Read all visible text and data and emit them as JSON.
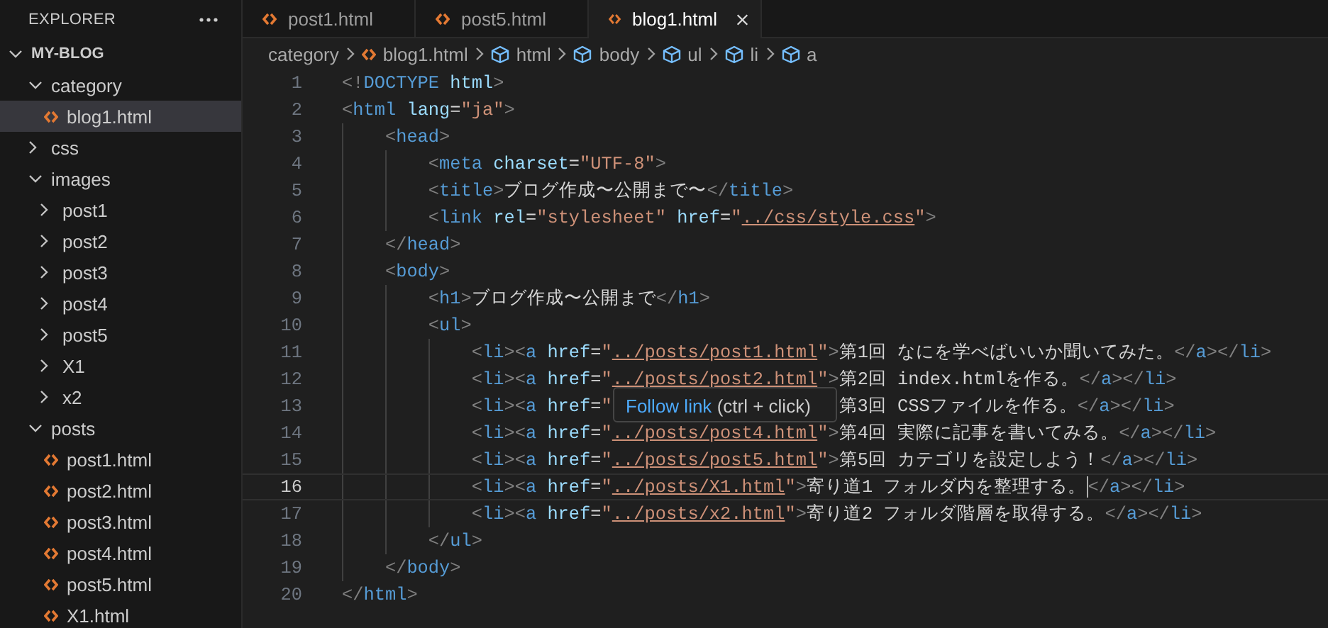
{
  "explorer": {
    "title": "EXPLORER"
  },
  "workspace": {
    "name": "MY-BLOG",
    "expanded": true,
    "children": [
      {
        "label": "category",
        "kind": "folder",
        "expanded": true,
        "selected": false,
        "children": [
          {
            "label": "blog1.html",
            "kind": "file",
            "selected": true
          }
        ]
      },
      {
        "label": "css",
        "kind": "folder",
        "expanded": false,
        "selected": false
      },
      {
        "label": "images",
        "kind": "folder",
        "expanded": true,
        "selected": false,
        "children": [
          {
            "label": "post1",
            "kind": "folder",
            "expanded": false,
            "selected": false
          },
          {
            "label": "post2",
            "kind": "folder",
            "expanded": false,
            "selected": false
          },
          {
            "label": "post3",
            "kind": "folder",
            "expanded": false,
            "selected": false
          },
          {
            "label": "post4",
            "kind": "folder",
            "expanded": false,
            "selected": false
          },
          {
            "label": "post5",
            "kind": "folder",
            "expanded": false,
            "selected": false
          },
          {
            "label": "X1",
            "kind": "folder",
            "expanded": false,
            "selected": false
          },
          {
            "label": "x2",
            "kind": "folder",
            "expanded": false,
            "selected": false
          }
        ]
      },
      {
        "label": "posts",
        "kind": "folder",
        "expanded": true,
        "selected": false,
        "children": [
          {
            "label": "post1.html",
            "kind": "file",
            "selected": false
          },
          {
            "label": "post2.html",
            "kind": "file",
            "selected": false
          },
          {
            "label": "post3.html",
            "kind": "file",
            "selected": false
          },
          {
            "label": "post4.html",
            "kind": "file",
            "selected": false
          },
          {
            "label": "post5.html",
            "kind": "file",
            "selected": false
          },
          {
            "label": "X1.html",
            "kind": "file",
            "selected": false
          }
        ]
      }
    ]
  },
  "tabs": [
    {
      "label": "post1.html",
      "selected": false
    },
    {
      "label": "post5.html",
      "selected": false
    },
    {
      "label": "blog1.html",
      "selected": true
    }
  ],
  "breadcrumb": [
    {
      "label": "category",
      "kind": "folder"
    },
    {
      "label": "blog1.html",
      "kind": "file"
    },
    {
      "label": "html",
      "kind": "element"
    },
    {
      "label": "body",
      "kind": "element"
    },
    {
      "label": "ul",
      "kind": "element"
    },
    {
      "label": "li",
      "kind": "element"
    },
    {
      "label": "a",
      "kind": "element"
    }
  ],
  "lines": [
    {
      "number": "1",
      "current": false,
      "tokens": [
        {
          "kind": "punct",
          "text": "<!"
        },
        {
          "kind": "tag",
          "text": "DOCTYPE"
        },
        {
          "kind": "attr",
          "text": " html"
        },
        {
          "kind": "punct",
          "text": ">"
        }
      ]
    },
    {
      "number": "2",
      "current": false,
      "tokens": [
        {
          "kind": "punct",
          "text": "<"
        },
        {
          "kind": "tag",
          "text": "html"
        },
        {
          "kind": "attr",
          "text": " lang"
        },
        {
          "kind": "text",
          "text": "="
        },
        {
          "kind": "string",
          "text": "\"ja\""
        },
        {
          "kind": "punct",
          "text": ">"
        }
      ],
      "children": [
        {
          "number": "3",
          "current": false,
          "tokens": [
            {
              "kind": "punct",
              "text": "<"
            },
            {
              "kind": "tag",
              "text": "head"
            },
            {
              "kind": "punct",
              "text": ">"
            }
          ],
          "children": [
            {
              "number": "4",
              "current": false,
              "tokens": [
                {
                  "kind": "punct",
                  "text": "<"
                },
                {
                  "kind": "tag",
                  "text": "meta"
                },
                {
                  "kind": "attr",
                  "text": " charset"
                },
                {
                  "kind": "text",
                  "text": "="
                },
                {
                  "kind": "string",
                  "text": "\"UTF-8\""
                },
                {
                  "kind": "punct",
                  "text": ">"
                }
              ]
            },
            {
              "number": "5",
              "current": false,
              "tokens": [
                {
                  "kind": "punct",
                  "text": "<"
                },
                {
                  "kind": "tag",
                  "text": "title"
                },
                {
                  "kind": "punct",
                  "text": ">"
                },
                {
                  "kind": "text",
                  "text": "ブログ作成〜公開まで〜"
                },
                {
                  "kind": "punct",
                  "text": "</"
                },
                {
                  "kind": "tag",
                  "text": "title"
                },
                {
                  "kind": "punct",
                  "text": ">"
                }
              ]
            },
            {
              "number": "6",
              "current": false,
              "tokens": [
                {
                  "kind": "punct",
                  "text": "<"
                },
                {
                  "kind": "tag",
                  "text": "link"
                },
                {
                  "kind": "attr",
                  "text": " rel"
                },
                {
                  "kind": "text",
                  "text": "="
                },
                {
                  "kind": "string",
                  "text": "\"stylesheet\""
                },
                {
                  "kind": "attr",
                  "text": " href"
                },
                {
                  "kind": "text",
                  "text": "="
                },
                {
                  "kind": "string",
                  "text": "\""
                },
                {
                  "kind": "link",
                  "text": "../css/style.css"
                },
                {
                  "kind": "string",
                  "text": "\""
                },
                {
                  "kind": "punct",
                  "text": ">"
                }
              ]
            }
          ]
        },
        {
          "number": "7",
          "current": false,
          "tokens": [
            {
              "kind": "punct",
              "text": "</"
            },
            {
              "kind": "tag",
              "text": "head"
            },
            {
              "kind": "punct",
              "text": ">"
            }
          ]
        },
        {
          "number": "8",
          "current": false,
          "tokens": [
            {
              "kind": "punct",
              "text": "<"
            },
            {
              "kind": "tag",
              "text": "body"
            },
            {
              "kind": "punct",
              "text": ">"
            }
          ],
          "children": [
            {
              "number": "9",
              "current": false,
              "tokens": [
                {
                  "kind": "punct",
                  "text": "<"
                },
                {
                  "kind": "tag",
                  "text": "h1"
                },
                {
                  "kind": "punct",
                  "text": ">"
                },
                {
                  "kind": "text",
                  "text": "ブログ作成〜公開まで"
                },
                {
                  "kind": "punct",
                  "text": "</"
                },
                {
                  "kind": "tag",
                  "text": "h1"
                },
                {
                  "kind": "punct",
                  "text": ">"
                }
              ]
            },
            {
              "number": "10",
              "current": false,
              "tokens": [
                {
                  "kind": "punct",
                  "text": "<"
                },
                {
                  "kind": "tag",
                  "text": "ul"
                },
                {
                  "kind": "punct",
                  "text": ">"
                }
              ],
              "children": [
                {
                  "number": "11",
                  "current": false,
                  "tokens": [
                    {
                      "kind": "punct",
                      "text": "<"
                    },
                    {
                      "kind": "tag",
                      "text": "li"
                    },
                    {
                      "kind": "punct",
                      "text": "><"
                    },
                    {
                      "kind": "tag",
                      "text": "a"
                    },
                    {
                      "kind": "attr",
                      "text": " href"
                    },
                    {
                      "kind": "text",
                      "text": "="
                    },
                    {
                      "kind": "string",
                      "text": "\""
                    },
                    {
                      "kind": "link",
                      "text": "../posts/post1.html"
                    },
                    {
                      "kind": "string",
                      "text": "\""
                    },
                    {
                      "kind": "punct",
                      "text": ">"
                    },
                    {
                      "kind": "text",
                      "text": "第1回 なにを学べばいいか聞いてみた。"
                    },
                    {
                      "kind": "punct",
                      "text": "</"
                    },
                    {
                      "kind": "tag",
                      "text": "a"
                    },
                    {
                      "kind": "punct",
                      "text": "></"
                    },
                    {
                      "kind": "tag",
                      "text": "li"
                    },
                    {
                      "kind": "punct",
                      "text": ">"
                    }
                  ]
                },
                {
                  "number": "12",
                  "current": false,
                  "tokens": [
                    {
                      "kind": "punct",
                      "text": "<"
                    },
                    {
                      "kind": "tag",
                      "text": "li"
                    },
                    {
                      "kind": "punct",
                      "text": "><"
                    },
                    {
                      "kind": "tag",
                      "text": "a"
                    },
                    {
                      "kind": "attr",
                      "text": " href"
                    },
                    {
                      "kind": "text",
                      "text": "="
                    },
                    {
                      "kind": "string",
                      "text": "\""
                    },
                    {
                      "kind": "link",
                      "text": "../posts/post2.html"
                    },
                    {
                      "kind": "string",
                      "text": "\""
                    },
                    {
                      "kind": "punct",
                      "text": ">"
                    },
                    {
                      "kind": "text",
                      "text": "第2回 index.htmlを作る。"
                    },
                    {
                      "kind": "punct",
                      "text": "</"
                    },
                    {
                      "kind": "tag",
                      "text": "a"
                    },
                    {
                      "kind": "punct",
                      "text": "></"
                    },
                    {
                      "kind": "tag",
                      "text": "li"
                    },
                    {
                      "kind": "punct",
                      "text": ">"
                    }
                  ]
                },
                {
                  "number": "13",
                  "current": false,
                  "tokens": [
                    {
                      "kind": "punct",
                      "text": "<"
                    },
                    {
                      "kind": "tag",
                      "text": "li"
                    },
                    {
                      "kind": "punct",
                      "text": "><"
                    },
                    {
                      "kind": "tag",
                      "text": "a"
                    },
                    {
                      "kind": "attr",
                      "text": " href"
                    },
                    {
                      "kind": "text",
                      "text": "="
                    },
                    {
                      "kind": "string",
                      "text": "\""
                    },
                    {
                      "kind": "covered"
                    },
                    {
                      "kind": "text",
                      "text": "第3回 CSSファイルを作る。"
                    },
                    {
                      "kind": "punct",
                      "text": "</"
                    },
                    {
                      "kind": "tag",
                      "text": "a"
                    },
                    {
                      "kind": "punct",
                      "text": "></"
                    },
                    {
                      "kind": "tag",
                      "text": "li"
                    },
                    {
                      "kind": "punct",
                      "text": ">"
                    }
                  ]
                },
                {
                  "number": "14",
                  "current": false,
                  "tokens": [
                    {
                      "kind": "punct",
                      "text": "<"
                    },
                    {
                      "kind": "tag",
                      "text": "li"
                    },
                    {
                      "kind": "punct",
                      "text": "><"
                    },
                    {
                      "kind": "tag",
                      "text": "a"
                    },
                    {
                      "kind": "attr",
                      "text": " href"
                    },
                    {
                      "kind": "text",
                      "text": "="
                    },
                    {
                      "kind": "string",
                      "text": "\""
                    },
                    {
                      "kind": "link",
                      "text": "../posts/post4.html"
                    },
                    {
                      "kind": "string",
                      "text": "\""
                    },
                    {
                      "kind": "punct",
                      "text": ">"
                    },
                    {
                      "kind": "text",
                      "text": "第4回 実際に記事を書いてみる。"
                    },
                    {
                      "kind": "punct",
                      "text": "</"
                    },
                    {
                      "kind": "tag",
                      "text": "a"
                    },
                    {
                      "kind": "punct",
                      "text": "></"
                    },
                    {
                      "kind": "tag",
                      "text": "li"
                    },
                    {
                      "kind": "punct",
                      "text": ">"
                    }
                  ]
                },
                {
                  "number": "15",
                  "current": false,
                  "tokens": [
                    {
                      "kind": "punct",
                      "text": "<"
                    },
                    {
                      "kind": "tag",
                      "text": "li"
                    },
                    {
                      "kind": "punct",
                      "text": "><"
                    },
                    {
                      "kind": "tag",
                      "text": "a"
                    },
                    {
                      "kind": "attr",
                      "text": " href"
                    },
                    {
                      "kind": "text",
                      "text": "="
                    },
                    {
                      "kind": "string",
                      "text": "\""
                    },
                    {
                      "kind": "link",
                      "text": "../posts/post5.html"
                    },
                    {
                      "kind": "string",
                      "text": "\""
                    },
                    {
                      "kind": "punct",
                      "text": ">"
                    },
                    {
                      "kind": "text",
                      "text": "第5回 カテゴリを設定しよう！"
                    },
                    {
                      "kind": "punct",
                      "text": "</"
                    },
                    {
                      "kind": "tag",
                      "text": "a"
                    },
                    {
                      "kind": "punct",
                      "text": "></"
                    },
                    {
                      "kind": "tag",
                      "text": "li"
                    },
                    {
                      "kind": "punct",
                      "text": ">"
                    }
                  ]
                },
                {
                  "number": "16",
                  "current": true,
                  "tokens": [
                    {
                      "kind": "punct",
                      "text": "<"
                    },
                    {
                      "kind": "tag",
                      "text": "li"
                    },
                    {
                      "kind": "punct",
                      "text": "><"
                    },
                    {
                      "kind": "tag",
                      "text": "a"
                    },
                    {
                      "kind": "attr",
                      "text": " href"
                    },
                    {
                      "kind": "text",
                      "text": "="
                    },
                    {
                      "kind": "string",
                      "text": "\""
                    },
                    {
                      "kind": "link",
                      "text": "../posts/X1.html"
                    },
                    {
                      "kind": "string",
                      "text": "\""
                    },
                    {
                      "kind": "punct",
                      "text": ">"
                    },
                    {
                      "kind": "text",
                      "text": "寄り道1 フォルダ内を整理する。"
                    },
                    {
                      "kind": "cursor"
                    },
                    {
                      "kind": "punct",
                      "text": "</"
                    },
                    {
                      "kind": "tag",
                      "text": "a"
                    },
                    {
                      "kind": "punct",
                      "text": "></"
                    },
                    {
                      "kind": "tag",
                      "text": "li"
                    },
                    {
                      "kind": "punct",
                      "text": ">"
                    }
                  ]
                },
                {
                  "number": "17",
                  "current": false,
                  "tokens": [
                    {
                      "kind": "punct",
                      "text": "<"
                    },
                    {
                      "kind": "tag",
                      "text": "li"
                    },
                    {
                      "kind": "punct",
                      "text": "><"
                    },
                    {
                      "kind": "tag",
                      "text": "a"
                    },
                    {
                      "kind": "attr",
                      "text": " href"
                    },
                    {
                      "kind": "text",
                      "text": "="
                    },
                    {
                      "kind": "string",
                      "text": "\""
                    },
                    {
                      "kind": "link",
                      "text": "../posts/x2.html"
                    },
                    {
                      "kind": "string",
                      "text": "\""
                    },
                    {
                      "kind": "punct",
                      "text": ">"
                    },
                    {
                      "kind": "text",
                      "text": "寄り道2 フォルダ階層を取得する。"
                    },
                    {
                      "kind": "punct",
                      "text": "</"
                    },
                    {
                      "kind": "tag",
                      "text": "a"
                    },
                    {
                      "kind": "punct",
                      "text": "></"
                    },
                    {
                      "kind": "tag",
                      "text": "li"
                    },
                    {
                      "kind": "punct",
                      "text": ">"
                    }
                  ]
                }
              ]
            },
            {
              "number": "18",
              "current": false,
              "tokens": [
                {
                  "kind": "punct",
                  "text": "</"
                },
                {
                  "kind": "tag",
                  "text": "ul"
                },
                {
                  "kind": "punct",
                  "text": ">"
                }
              ]
            }
          ]
        },
        {
          "number": "19",
          "current": false,
          "tokens": [
            {
              "kind": "punct",
              "text": "</"
            },
            {
              "kind": "tag",
              "text": "body"
            },
            {
              "kind": "punct",
              "text": ">"
            }
          ]
        }
      ]
    },
    {
      "number": "20",
      "current": false,
      "tokens": [
        {
          "kind": "punct",
          "text": "</"
        },
        {
          "kind": "tag",
          "text": "html"
        },
        {
          "kind": "punct",
          "text": ">"
        }
      ]
    }
  ],
  "hover_tooltip": {
    "link": "Follow link",
    "hint": "(ctrl + click)"
  }
}
